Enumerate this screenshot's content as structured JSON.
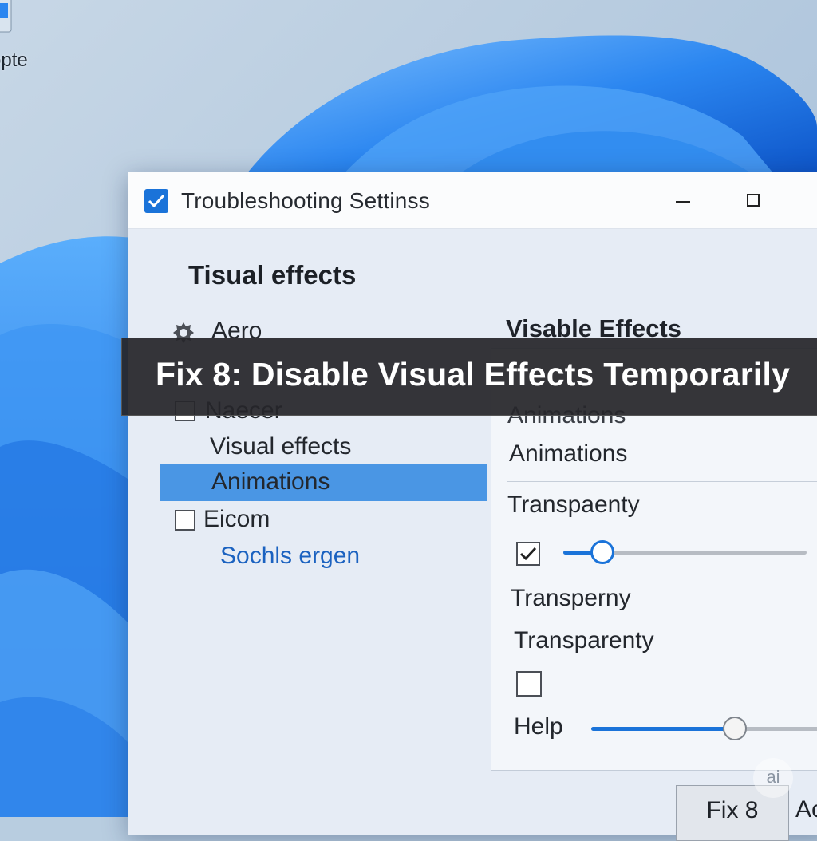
{
  "desktop": {
    "icon_label": "opte"
  },
  "window": {
    "title": "Troubleshooting Settinss",
    "section_title": "Tisual effects",
    "tree": {
      "aero": "Aero",
      "naecer": "Naecer",
      "visual_effects": "Visual effects",
      "animations": "Animations",
      "eicom": "Eicom",
      "link": "Sochls ergen"
    },
    "right_panel": {
      "heading": "Visable Effects",
      "animations_1": "Animations",
      "animations_2": "Animations",
      "transparency_1": "Transpaenty",
      "transparency_2": "Transperny",
      "transparency_3": "Transparenty",
      "help": "Help",
      "slider1_value": 0.16,
      "slider2_value": 0.6,
      "checkbox1_checked": true,
      "checkbox2_checked": false
    },
    "buttons": {
      "fix": "Fix 8",
      "apply": "Ac"
    }
  },
  "banner": {
    "text": "Fix 8: Disable Visual Effects Temporarily"
  },
  "watermark": "ai",
  "colors": {
    "accent": "#1a73d9",
    "selection": "#4a96e4",
    "banner_bg": "#26262a"
  }
}
